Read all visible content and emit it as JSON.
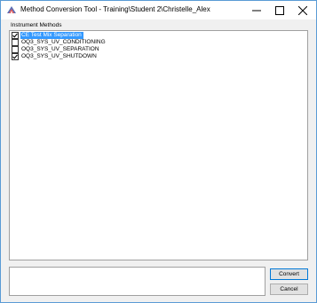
{
  "window": {
    "title": "Method Conversion Tool - Training\\Student 2\\Christelle_Alex"
  },
  "instrument_methods": {
    "label": "Instrument Methods",
    "items": [
      {
        "label": "CE Test Mix Separation",
        "checked": true,
        "selected": true
      },
      {
        "label": "OQ3_SYS_UV_CONDITIONING",
        "checked": false,
        "selected": false
      },
      {
        "label": "OQ3_SYS_UV_SEPARATION",
        "checked": false,
        "selected": false
      },
      {
        "label": "OQ3_SYS_UV_SHUTDOWN",
        "checked": true,
        "selected": false
      }
    ]
  },
  "output": {
    "text": ""
  },
  "buttons": {
    "convert_label": "Convert",
    "cancel_label": "Cancel"
  }
}
